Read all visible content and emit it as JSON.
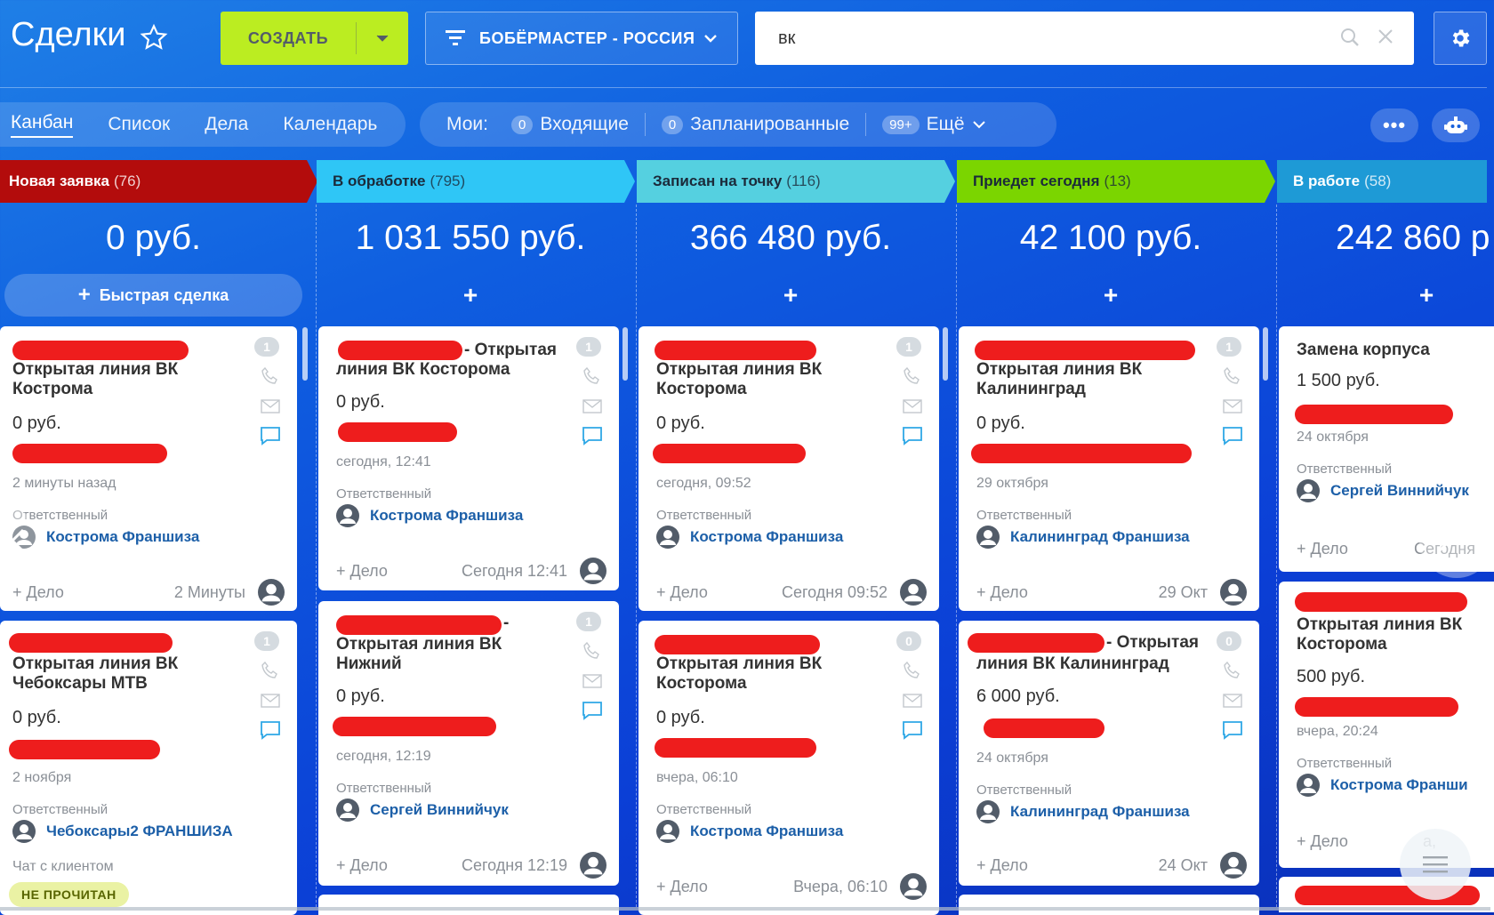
{
  "header": {
    "title": "Сделки",
    "create_label": "СОЗДАТЬ",
    "filter_label": "БОБЁРМАСТЕР - РОССИЯ",
    "search_value": "вк"
  },
  "views": {
    "tabs": [
      "Канбан",
      "Список",
      "Дела",
      "Календарь"
    ],
    "active": "Канбан"
  },
  "mine": {
    "label": "Мои:",
    "incoming_count": "0",
    "incoming_label": "Входящие",
    "planned_count": "0",
    "planned_label": "Запланированные",
    "more_count": "99+",
    "more_label": "Ещё"
  },
  "columns": [
    {
      "name": "Новая заявка",
      "count": "(76)",
      "sum": "0 руб.",
      "quick_label": "Быстрая сделка",
      "color": "#b30c0c"
    },
    {
      "name": "В обработке",
      "count": "(795)",
      "sum": "1 031 550 руб.",
      "color": "#2fc6f6"
    },
    {
      "name": "Записан на точку",
      "count": "(116)",
      "sum": "366 480 руб.",
      "color": "#55d0e0"
    },
    {
      "name": "Приедет сегодня",
      "count": "(13)",
      "sum": "42 100 руб.",
      "color": "#7bd500"
    },
    {
      "name": "В работе",
      "count": "(58)",
      "sum": "242 860 р",
      "color": "#1e9ad6"
    }
  ],
  "common": {
    "responsible_label": "Ответственный",
    "add_task": "+ Дело",
    "chat_label": "Чат с клиентом",
    "unread_label": "НЕ ПРОЧИТАН"
  },
  "cards": {
    "c1": {
      "badge": "1",
      "title": "Открытая линия ВК Кострома",
      "sum": "0 руб.",
      "date": "2 минуты назад",
      "resp": "Кострома Франшиза",
      "time": "2 Минуты"
    },
    "c2": {
      "badge": "1",
      "title": "Открытая линия ВК Чебоксары МТВ",
      "sum": "0 руб.",
      "date": "2 ноября",
      "resp": "Чебоксары2 ФРАНШИЗА"
    },
    "c3": {
      "badge": "1",
      "title_end": "- Открытая",
      "title": "линия ВК Косторома",
      "sum": "0 руб.",
      "date": "сегодня, 12:41",
      "resp": "Кострома Франшиза",
      "time": "Сегодня 12:41"
    },
    "c4": {
      "badge": "1",
      "title": "Открытая линия ВК Нижний",
      "sum": "0 руб.",
      "date": "сегодня, 12:19",
      "resp": "Сергей Виннийчук",
      "time": "Сегодня 12:19"
    },
    "c5": {
      "badge": "1",
      "title": "Открытая линия ВК Косторома",
      "sum": "0 руб.",
      "date": "сегодня, 09:52",
      "resp": "Кострома Франшиза",
      "time": "Сегодня 09:52"
    },
    "c6": {
      "badge": "0",
      "title": "Открытая линия ВК Косторома",
      "sum": "0 руб.",
      "date": "вчера, 06:10",
      "resp": "Кострома Франшиза",
      "time": "Вчера, 06:10"
    },
    "c7": {
      "badge": "1",
      "title": "Открытая линия ВК Калининград",
      "sum": "0 руб.",
      "date": "29 октября",
      "resp": "Калининград Франшиза",
      "time": "29 Окт"
    },
    "c8": {
      "badge": "0",
      "title_end": "- Открытая",
      "title": "линия ВК Калининград",
      "sum": "6 000 руб.",
      "date": "24 октября",
      "resp": "Калининград Франшиза",
      "time": "24 Окт"
    },
    "c9": {
      "title": "Замена корпуса",
      "sum": "1 500 руб.",
      "date": "24 октября",
      "resp": "Сергей Виннийчук",
      "time": "Сегодня"
    },
    "c10": {
      "title": "Открытая линия ВК Косторома",
      "sum": "500 руб.",
      "date": "вчера, 20:24",
      "resp": "Кострома Франши",
      "time": "а,"
    }
  },
  "colors": {
    "accent": "#2fc6f6",
    "create": "#bbed21",
    "link": "#1c5fa8",
    "redaction": "#ee1d1d"
  }
}
